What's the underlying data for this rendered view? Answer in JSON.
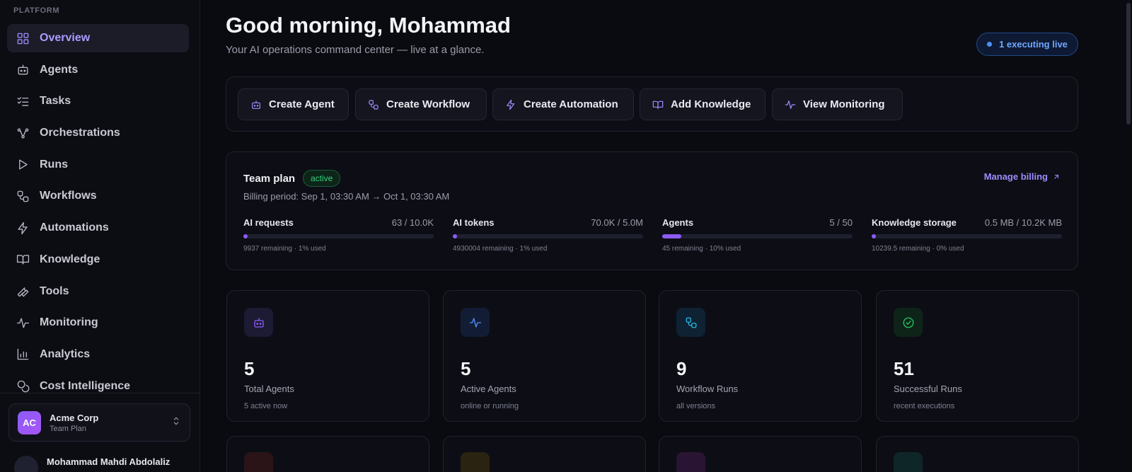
{
  "sidebar": {
    "section_label": "PLATFORM",
    "items": [
      {
        "label": "Overview",
        "icon": "grid-icon",
        "active": true
      },
      {
        "label": "Agents",
        "icon": "bot-icon"
      },
      {
        "label": "Tasks",
        "icon": "checklist-icon"
      },
      {
        "label": "Orchestrations",
        "icon": "nodes-icon"
      },
      {
        "label": "Runs",
        "icon": "play-icon"
      },
      {
        "label": "Workflows",
        "icon": "workflow-icon"
      },
      {
        "label": "Automations",
        "icon": "bolt-icon"
      },
      {
        "label": "Knowledge",
        "icon": "book-icon"
      },
      {
        "label": "Tools",
        "icon": "wrench-icon"
      },
      {
        "label": "Monitoring",
        "icon": "activity-icon"
      },
      {
        "label": "Analytics",
        "icon": "bar-chart-icon"
      },
      {
        "label": "Cost Intelligence",
        "icon": "coins-icon"
      }
    ],
    "org": {
      "initials": "AC",
      "name": "Acme Corp",
      "plan": "Team Plan"
    },
    "user": {
      "name": "Mohammad Mahdi Abdolaliz"
    }
  },
  "header": {
    "greeting": "Good morning, Mohammad",
    "subtitle": "Your AI operations command center — live at a glance.",
    "live_status": "1 executing live"
  },
  "quick_actions": [
    {
      "label": "Create Agent",
      "icon": "bot-icon"
    },
    {
      "label": "Create Workflow",
      "icon": "workflow-icon"
    },
    {
      "label": "Create Automation",
      "icon": "bolt-icon"
    },
    {
      "label": "Add Knowledge",
      "icon": "book-icon"
    },
    {
      "label": "View Monitoring",
      "icon": "activity-icon"
    }
  ],
  "plan": {
    "title": "Team plan",
    "status": "active",
    "billing_period": "Billing period: Sep 1, 03:30 AM → Oct 1, 03:30 AM",
    "manage_label": "Manage billing",
    "usage": [
      {
        "label": "AI requests",
        "value": "63 / 10.0K",
        "note": "9937 remaining · 1% used",
        "fraction": 0.01
      },
      {
        "label": "AI tokens",
        "value": "70.0K / 5.0M",
        "note": "4930004 remaining · 1% used",
        "fraction": 0.01
      },
      {
        "label": "Agents",
        "value": "5 / 50",
        "note": "45 remaining · 10% used",
        "fraction": 0.1
      },
      {
        "label": "Knowledge storage",
        "value": "0.5 MB / 10.2K MB",
        "note": "10239.5 remaining · 0% used",
        "fraction": 0.0
      }
    ]
  },
  "stats": [
    {
      "value": "5",
      "label": "Total Agents",
      "sub": "5 active now",
      "icon": "bot-icon",
      "color": "#8b5cf6"
    },
    {
      "value": "5",
      "label": "Active Agents",
      "sub": "online or running",
      "icon": "activity-icon",
      "color": "#4f8ff7"
    },
    {
      "value": "9",
      "label": "Workflow Runs",
      "sub": "all versions",
      "icon": "workflow-icon",
      "color": "#22b8e6"
    },
    {
      "value": "51",
      "label": "Successful Runs",
      "sub": "recent executions",
      "icon": "check-circle-icon",
      "color": "#22c55e"
    }
  ],
  "colors": {
    "accent": "#8b5cf6",
    "live": "#4f8ff7",
    "success": "#22c55e"
  }
}
